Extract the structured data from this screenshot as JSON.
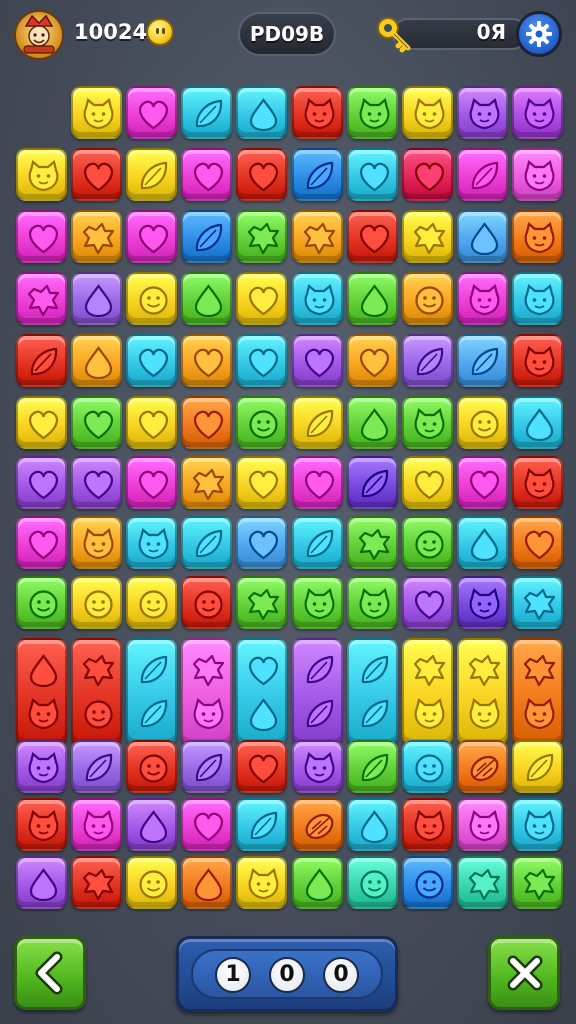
{
  "hud": {
    "score": "10024",
    "level_label": "PD09B",
    "key_value": "0Я"
  },
  "icons": {
    "avatar": "mascot-avatar-icon",
    "coin": "coin-icon",
    "key": "key-icon",
    "settings": "gear-icon",
    "back": "back-arrow-icon",
    "close": "close-x-icon"
  },
  "counter": {
    "digits": [
      "1",
      "0",
      "0"
    ]
  },
  "board": {
    "rows": [
      [
        {
          "col": 1,
          "color": "#f9d423",
          "shape": "cat"
        },
        {
          "col": 2,
          "color": "#ee3fd6",
          "shape": "heart"
        },
        {
          "col": 3,
          "color": "#35c8e8",
          "shape": "leaf"
        },
        {
          "col": 4,
          "color": "#35c8e8",
          "shape": "drop"
        },
        {
          "col": 5,
          "color": "#e33424",
          "shape": "cat"
        },
        {
          "col": 6,
          "color": "#63d03a",
          "shape": "cat"
        },
        {
          "col": 7,
          "color": "#f9d423",
          "shape": "cat"
        },
        {
          "col": 8,
          "color": "#a35ae8",
          "shape": "cat"
        },
        {
          "col": 9,
          "color": "#b24ee8",
          "shape": "cat"
        }
      ],
      [
        {
          "col": 0,
          "color": "#f9d423",
          "shape": "cat"
        },
        {
          "col": 1,
          "color": "#e33424",
          "shape": "heart"
        },
        {
          "col": 2,
          "color": "#f9d423",
          "shape": "leaf"
        },
        {
          "col": 3,
          "color": "#ee3fd6",
          "shape": "heart"
        },
        {
          "col": 4,
          "color": "#e33424",
          "shape": "heart"
        },
        {
          "col": 5,
          "color": "#2f8de8",
          "shape": "leaf"
        },
        {
          "col": 6,
          "color": "#35c8e8",
          "shape": "heart"
        },
        {
          "col": 7,
          "color": "#e3265a",
          "shape": "heart"
        },
        {
          "col": 8,
          "color": "#ee3fd6",
          "shape": "leaf"
        },
        {
          "col": 9,
          "color": "#ee5ee0",
          "shape": "cat"
        }
      ],
      [
        {
          "col": 0,
          "color": "#ee3fd6",
          "shape": "heart"
        },
        {
          "col": 1,
          "color": "#f9a623",
          "shape": "splat"
        },
        {
          "col": 2,
          "color": "#ee3fd6",
          "shape": "heart"
        },
        {
          "col": 3,
          "color": "#2f8de8",
          "shape": "leaf"
        },
        {
          "col": 4,
          "color": "#63d03a",
          "shape": "splat"
        },
        {
          "col": 5,
          "color": "#f9a623",
          "shape": "splat"
        },
        {
          "col": 6,
          "color": "#e33424",
          "shape": "heart"
        },
        {
          "col": 7,
          "color": "#f9d423",
          "shape": "splat"
        },
        {
          "col": 8,
          "color": "#52a8f0",
          "shape": "drop"
        },
        {
          "col": 9,
          "color": "#f37b1d",
          "shape": "cat"
        }
      ],
      [
        {
          "col": 0,
          "color": "#ee3fd6",
          "shape": "splat"
        },
        {
          "col": 1,
          "color": "#9a6ae8",
          "shape": "drop"
        },
        {
          "col": 2,
          "color": "#f9d423",
          "shape": "smile"
        },
        {
          "col": 3,
          "color": "#63d03a",
          "shape": "drop"
        },
        {
          "col": 4,
          "color": "#f9d423",
          "shape": "heart"
        },
        {
          "col": 5,
          "color": "#35c8e8",
          "shape": "cat"
        },
        {
          "col": 6,
          "color": "#63d03a",
          "shape": "drop"
        },
        {
          "col": 7,
          "color": "#f9a623",
          "shape": "smile"
        },
        {
          "col": 8,
          "color": "#ee3fd6",
          "shape": "cat"
        },
        {
          "col": 9,
          "color": "#35c8e8",
          "shape": "cat"
        }
      ],
      [
        {
          "col": 0,
          "color": "#e33424",
          "shape": "leaf"
        },
        {
          "col": 1,
          "color": "#f9a623",
          "shape": "drop"
        },
        {
          "col": 2,
          "color": "#35c8e8",
          "shape": "heart"
        },
        {
          "col": 3,
          "color": "#f9a623",
          "shape": "heart"
        },
        {
          "col": 4,
          "color": "#35c8e8",
          "shape": "heart"
        },
        {
          "col": 5,
          "color": "#a35ae8",
          "shape": "heart"
        },
        {
          "col": 6,
          "color": "#f9a623",
          "shape": "heart"
        },
        {
          "col": 7,
          "color": "#9a6ae8",
          "shape": "leaf"
        },
        {
          "col": 8,
          "color": "#52a8f0",
          "shape": "leaf"
        },
        {
          "col": 9,
          "color": "#e33424",
          "shape": "cat"
        }
      ],
      [
        {
          "col": 0,
          "color": "#f9d423",
          "shape": "heart"
        },
        {
          "col": 1,
          "color": "#63d03a",
          "shape": "heart"
        },
        {
          "col": 2,
          "color": "#f9d423",
          "shape": "heart"
        },
        {
          "col": 3,
          "color": "#f37b1d",
          "shape": "heart"
        },
        {
          "col": 4,
          "color": "#63d03a",
          "shape": "smile"
        },
        {
          "col": 5,
          "color": "#f9d423",
          "shape": "leaf"
        },
        {
          "col": 6,
          "color": "#63d03a",
          "shape": "drop"
        },
        {
          "col": 7,
          "color": "#63d03a",
          "shape": "cat"
        },
        {
          "col": 8,
          "color": "#f9d423",
          "shape": "smile"
        },
        {
          "col": 9,
          "color": "#35c8e8",
          "shape": "drop"
        }
      ],
      [
        {
          "col": 0,
          "color": "#a35ae8",
          "shape": "heart"
        },
        {
          "col": 1,
          "color": "#a35ae8",
          "shape": "heart"
        },
        {
          "col": 2,
          "color": "#ee3fd6",
          "shape": "heart"
        },
        {
          "col": 3,
          "color": "#f9a623",
          "shape": "splat"
        },
        {
          "col": 4,
          "color": "#f9d423",
          "shape": "heart"
        },
        {
          "col": 5,
          "color": "#ee3fd6",
          "shape": "heart"
        },
        {
          "col": 6,
          "color": "#7a4ae0",
          "shape": "leaf"
        },
        {
          "col": 7,
          "color": "#f9d423",
          "shape": "heart"
        },
        {
          "col": 8,
          "color": "#ee3fd6",
          "shape": "heart"
        },
        {
          "col": 9,
          "color": "#e33424",
          "shape": "cat"
        }
      ],
      [
        {
          "col": 0,
          "color": "#ee3fd6",
          "shape": "heart"
        },
        {
          "col": 1,
          "color": "#f9a623",
          "shape": "cat"
        },
        {
          "col": 2,
          "color": "#35c8e8",
          "shape": "cat"
        },
        {
          "col": 3,
          "color": "#35c8e8",
          "shape": "leaf"
        },
        {
          "col": 4,
          "color": "#52a8f0",
          "shape": "heart"
        },
        {
          "col": 5,
          "color": "#35c8e8",
          "shape": "leaf"
        },
        {
          "col": 6,
          "color": "#63d03a",
          "shape": "splat"
        },
        {
          "col": 7,
          "color": "#63d03a",
          "shape": "smile"
        },
        {
          "col": 8,
          "color": "#35c8e8",
          "shape": "drop"
        },
        {
          "col": 9,
          "color": "#f37b1d",
          "shape": "heart"
        }
      ],
      [
        {
          "col": 0,
          "color": "#63d03a",
          "shape": "smile"
        },
        {
          "col": 1,
          "color": "#f9d423",
          "shape": "smile"
        },
        {
          "col": 2,
          "color": "#f9d423",
          "shape": "smile"
        },
        {
          "col": 3,
          "color": "#e33424",
          "shape": "smile"
        },
        {
          "col": 4,
          "color": "#63d03a",
          "shape": "splat"
        },
        {
          "col": 5,
          "color": "#63d03a",
          "shape": "cat"
        },
        {
          "col": 6,
          "color": "#63d03a",
          "shape": "cat"
        },
        {
          "col": 7,
          "color": "#a35ae8",
          "shape": "heart"
        },
        {
          "col": 8,
          "color": "#7a4ae0",
          "shape": "cat"
        },
        {
          "col": 9,
          "color": "#35c8e8",
          "shape": "splat"
        }
      ],
      [
        {
          "col": 0,
          "color": "#e33424",
          "shape": "drop",
          "tall": true,
          "shape2": "cat"
        },
        {
          "col": 1,
          "color": "#e33424",
          "shape": "splat",
          "tall": true,
          "shape2": "smile"
        },
        {
          "col": 2,
          "color": "#35c8e8",
          "shape": "leaf",
          "tall": true,
          "shape2": "leaf"
        },
        {
          "col": 3,
          "color": "#ee5ee0",
          "shape": "splat",
          "tall": true,
          "shape2": "cat"
        },
        {
          "col": 4,
          "color": "#35c8e8",
          "shape": "heart",
          "tall": true,
          "shape2": "drop"
        },
        {
          "col": 5,
          "color": "#a35ae8",
          "shape": "leaf",
          "tall": true,
          "shape2": "leaf"
        },
        {
          "col": 6,
          "color": "#35c8e8",
          "shape": "leaf",
          "tall": true,
          "shape2": "leaf"
        },
        {
          "col": 7,
          "color": "#f9d423",
          "shape": "splat",
          "tall": true,
          "shape2": "cat"
        },
        {
          "col": 8,
          "color": "#f9d423",
          "shape": "splat",
          "tall": true,
          "shape2": "cat"
        },
        {
          "col": 9,
          "color": "#f37b1d",
          "shape": "splat",
          "tall": true,
          "shape2": "cat"
        }
      ],
      [
        {
          "col": 0,
          "color": "#a35ae8",
          "shape": "cat"
        },
        {
          "col": 1,
          "color": "#9a6ae8",
          "shape": "leaf"
        },
        {
          "col": 2,
          "color": "#e33424",
          "shape": "smile"
        },
        {
          "col": 3,
          "color": "#9a6ae8",
          "shape": "leaf"
        },
        {
          "col": 4,
          "color": "#e33424",
          "shape": "heart"
        },
        {
          "col": 5,
          "color": "#a35ae8",
          "shape": "cat"
        },
        {
          "col": 6,
          "color": "#63d03a",
          "shape": "leaf"
        },
        {
          "col": 7,
          "color": "#35c8e8",
          "shape": "smile"
        },
        {
          "col": 8,
          "color": "#f37b1d",
          "shape": "nut"
        },
        {
          "col": 9,
          "color": "#f9d423",
          "shape": "leaf"
        }
      ],
      [
        {
          "col": 0,
          "color": "#e33424",
          "shape": "cat"
        },
        {
          "col": 1,
          "color": "#ee3fd6",
          "shape": "cat"
        },
        {
          "col": 2,
          "color": "#a35ae8",
          "shape": "drop"
        },
        {
          "col": 3,
          "color": "#ee3fd6",
          "shape": "heart"
        },
        {
          "col": 4,
          "color": "#35c8e8",
          "shape": "leaf"
        },
        {
          "col": 5,
          "color": "#f37b1d",
          "shape": "nut"
        },
        {
          "col": 6,
          "color": "#35c8e8",
          "shape": "drop"
        },
        {
          "col": 7,
          "color": "#e33424",
          "shape": "cat"
        },
        {
          "col": 8,
          "color": "#ee5ee0",
          "shape": "cat"
        },
        {
          "col": 9,
          "color": "#35c8e8",
          "shape": "cat"
        }
      ],
      [
        {
          "col": 0,
          "color": "#a35ae8",
          "shape": "drop"
        },
        {
          "col": 1,
          "color": "#e33424",
          "shape": "splat"
        },
        {
          "col": 2,
          "color": "#f9d423",
          "shape": "smile"
        },
        {
          "col": 3,
          "color": "#f37b1d",
          "shape": "drop"
        },
        {
          "col": 4,
          "color": "#f9d423",
          "shape": "cat"
        },
        {
          "col": 5,
          "color": "#63d03a",
          "shape": "drop"
        },
        {
          "col": 6,
          "color": "#3ad6b0",
          "shape": "smile"
        },
        {
          "col": 7,
          "color": "#2f8de8",
          "shape": "smile"
        },
        {
          "col": 8,
          "color": "#3ad6b0",
          "shape": "splat"
        },
        {
          "col": 9,
          "color": "#63d03a",
          "shape": "splat"
        }
      ]
    ]
  }
}
